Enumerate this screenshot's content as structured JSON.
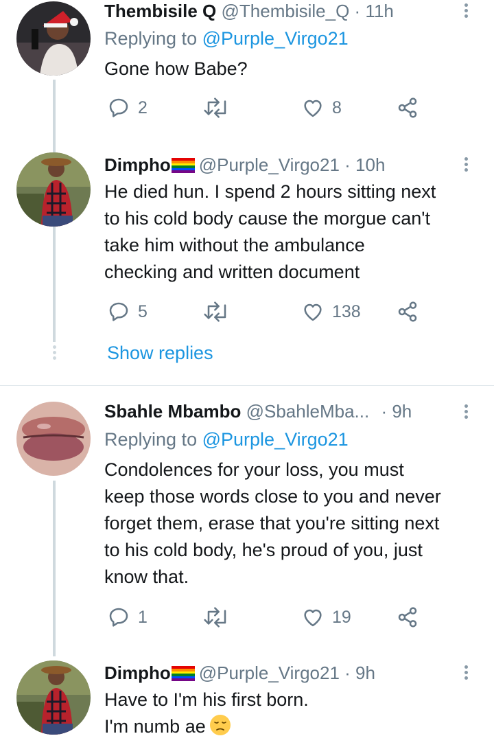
{
  "colors": {
    "link": "#1b95e0",
    "secondary": "#657786",
    "text": "#14171a",
    "thread_line": "#cfd9de"
  },
  "tweets": [
    {
      "name": "Thembisile Q",
      "handle": "@Thembisile_Q",
      "time": "· 11h",
      "replying_prefix": "Replying to",
      "replying_to": "@Purple_Virgo21",
      "lines": [
        "Gone how Babe?"
      ],
      "replies": "2",
      "retweets": "",
      "likes": "8",
      "icons": [
        "reply-icon",
        "retweet-icon",
        "heart-icon",
        "share-icon",
        "more-options-icon"
      ]
    },
    {
      "name": "Dimpho",
      "handle": "@Purple_Virgo21",
      "time": "· 10h",
      "lines": [
        "He died hun. I spend 2 hours sitting next",
        "to  his cold body cause the morgue can't",
        "take him without the ambulance",
        "checking and written document"
      ],
      "replies": "5",
      "retweets": "",
      "likes": "138",
      "show_replies": "Show replies"
    },
    {
      "name": "Sbahle Mbambo",
      "handle": "@SbahleMba...",
      "time": "· 9h",
      "replying_prefix": "Replying to",
      "replying_to": "@Purple_Virgo21",
      "lines": [
        "Condolences for your loss, you must",
        "keep those words close to you and never",
        "forget them, erase that you're sitting next",
        "to his cold body, he's proud of you, just",
        "know that."
      ],
      "replies": "1",
      "retweets": "",
      "likes": "19"
    },
    {
      "name": "Dimpho",
      "handle": "@Purple_Virgo21",
      "time": "· 9h",
      "lines": [
        "Have to I'm his first born.",
        "I'm numb ae"
      ]
    }
  ]
}
